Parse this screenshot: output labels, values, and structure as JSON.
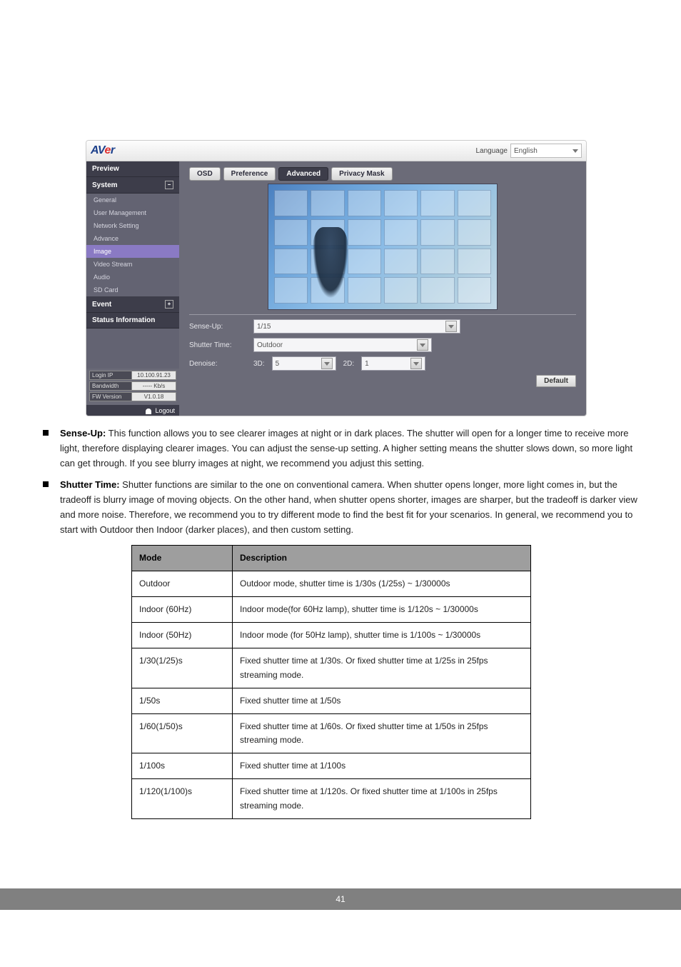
{
  "header": {
    "logo_a": "A",
    "logo_v": "V",
    "logo_e": "e",
    "logo_r": "r",
    "language_label": "Language",
    "language_value": "English"
  },
  "sidebar": {
    "sections": {
      "preview": "Preview",
      "system": "System",
      "event": "Event",
      "status_info": "Status Information"
    },
    "items": {
      "general": "General",
      "user_mgmt": "User Management",
      "network": "Network Setting",
      "advance": "Advance",
      "image": "Image",
      "video_stream": "Video Stream",
      "audio": "Audio",
      "sd_card": "SD Card"
    },
    "status": {
      "login_ip_label": "Login IP",
      "login_ip_value": "10.100.91.23",
      "bandwidth_label": "Bandwidth",
      "bandwidth_value": "----- Kb/s",
      "fw_label": "FW Version",
      "fw_value": "V1.0.18"
    },
    "logout": "Logout"
  },
  "tabs": {
    "osd": "OSD",
    "preference": "Preference",
    "advanced": "Advanced",
    "privacy": "Privacy Mask"
  },
  "form": {
    "sense_up_label": "Sense-Up:",
    "sense_up_value": "1/15",
    "shutter_label": "Shutter Time:",
    "shutter_value": "Outdoor",
    "denoise_label": "Denoise:",
    "denoise_3d_label": "3D:",
    "denoise_3d_value": "5",
    "denoise_2d_label": "2D:",
    "denoise_2d_value": "1",
    "default_btn": "Default"
  },
  "doc": {
    "bullet1_title": "Sense-Up:",
    "bullet1_text": " This function allows you to see clearer images at night or in dark places. The shutter will open for a longer time to receive more light, therefore displaying clearer images. You can adjust the sense-up setting. A higher setting means the shutter slows down, so more light can get through. If you see blurry images at night, we recommend you adjust this setting.",
    "bullet2_title": "Shutter Time:",
    "bullet2_text": " Shutter functions are similar to the one on conventional camera. When shutter opens longer, more light comes in, but the tradeoff is blurry image of moving objects. On the other hand, when shutter opens shorter, images are sharper, but the tradeoff is darker view and more noise. Therefore, we recommend you to try different mode to find the best fit for your scenarios. In general, we recommend you to start with Outdoor then Indoor (darker places), and then custom setting.",
    "table": {
      "col_mode": "Mode",
      "col_desc": "Description",
      "rows": [
        {
          "mode": "Outdoor",
          "desc": "Outdoor mode, shutter time is 1/30s (1/25s) ~ 1/30000s"
        },
        {
          "mode": "Indoor (60Hz)",
          "desc": "Indoor mode(for 60Hz lamp), shutter time is 1/120s ~ 1/30000s"
        },
        {
          "mode": "Indoor (50Hz)",
          "desc": "Indoor mode (for 50Hz lamp), shutter time is 1/100s ~ 1/30000s"
        },
        {
          "mode": "1/30(1/25)s",
          "desc": "Fixed shutter time at 1/30s. Or fixed shutter time at 1/25s in 25fps streaming mode."
        },
        {
          "mode": "1/50s",
          "desc": "Fixed shutter time at 1/50s"
        },
        {
          "mode": "1/60(1/50)s",
          "desc": "Fixed shutter time at 1/60s. Or fixed shutter time at 1/50s in 25fps streaming mode."
        },
        {
          "mode": "1/100s",
          "desc": "Fixed shutter time at 1/100s"
        },
        {
          "mode": "1/120(1/100)s",
          "desc": "Fixed shutter time at 1/120s. Or fixed shutter time at 1/100s in 25fps streaming mode."
        }
      ]
    }
  },
  "footer": {
    "page": "41"
  }
}
